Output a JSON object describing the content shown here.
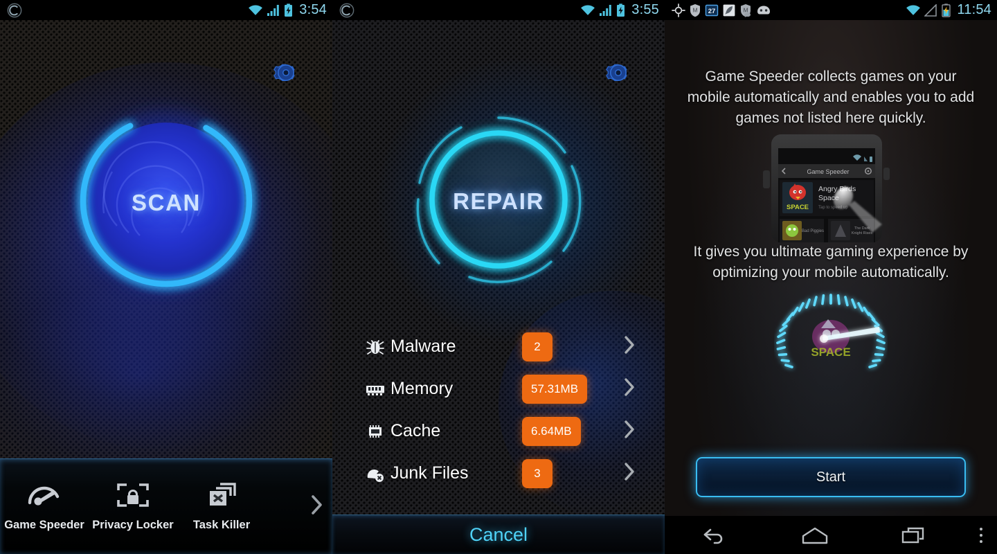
{
  "screens": [
    {
      "name": "scan-screen",
      "statusbar": {
        "time": "3:54",
        "icons": [
          "app-logo-icon",
          "wifi-icon",
          "signal-icon",
          "battery-charging-icon"
        ]
      },
      "gear_label": "settings-gear",
      "main_button": {
        "label": "SCAN",
        "ring_color": "#29a9f2",
        "fill_color": "#2033c8"
      },
      "dock": {
        "items": [
          {
            "label": "Game Speeder",
            "icon": "speedometer-icon"
          },
          {
            "label": "Privacy Locker",
            "icon": "lock-icon"
          },
          {
            "label": "Task Killer",
            "icon": "window-close-icon"
          }
        ],
        "more_icon": "chevron-right-icon"
      }
    },
    {
      "name": "repair-screen",
      "statusbar": {
        "time": "3:55",
        "icons": [
          "app-logo-icon",
          "wifi-icon",
          "signal-icon",
          "battery-charging-icon"
        ]
      },
      "gear_label": "settings-gear",
      "main_button": {
        "label": "REPAIR",
        "ring_color": "#2ad8f5"
      },
      "list": [
        {
          "icon": "bug-icon",
          "label": "Malware",
          "badge": "2"
        },
        {
          "icon": "ram-icon",
          "label": "Memory",
          "badge": "57.31MB"
        },
        {
          "icon": "chip-icon",
          "label": "Cache",
          "badge": "6.64MB"
        },
        {
          "icon": "junk-file-icon",
          "label": "Junk Files",
          "badge": "3"
        }
      ],
      "badge_color": "#ee6a12",
      "cancel_label": "Cancel",
      "cancel_color": "#4fd2f7"
    },
    {
      "name": "game-speeder-intro-screen",
      "statusbar": {
        "time": "11:54",
        "icons": [
          "gps-icon",
          "shield-icon",
          "calendar-27-icon",
          "feather-icon",
          "shield-chat-icon",
          "cyanogenmod-icon",
          "wifi-icon",
          "signal-no-service-icon",
          "battery-charging-icon"
        ],
        "calendar_day": "27"
      },
      "headline": "Game Speeder collects games on your mobile automatically and enables you to add games not listed here quickly.",
      "subline": "It gives you ultimate gaming experience by optimizing your mobile automatically.",
      "phone_mock": {
        "title": "Game Speeder",
        "game_title_line1": "Angry Birds",
        "game_title_line2": "Space",
        "tile_label": "SPACE",
        "tile2_label": "Bad Piggies",
        "tile3_label": "The Dark Knight Rises",
        "back_icon": "chevron-left-icon",
        "gear_icon": "gear-icon"
      },
      "speedometer": {
        "label": "SPACE",
        "accent": "#3fd4f8"
      },
      "start_label": "Start",
      "navbar": [
        {
          "icon": "back-icon"
        },
        {
          "icon": "home-icon"
        },
        {
          "icon": "recents-icon"
        },
        {
          "icon": "overflow-menu-icon"
        }
      ]
    }
  ]
}
